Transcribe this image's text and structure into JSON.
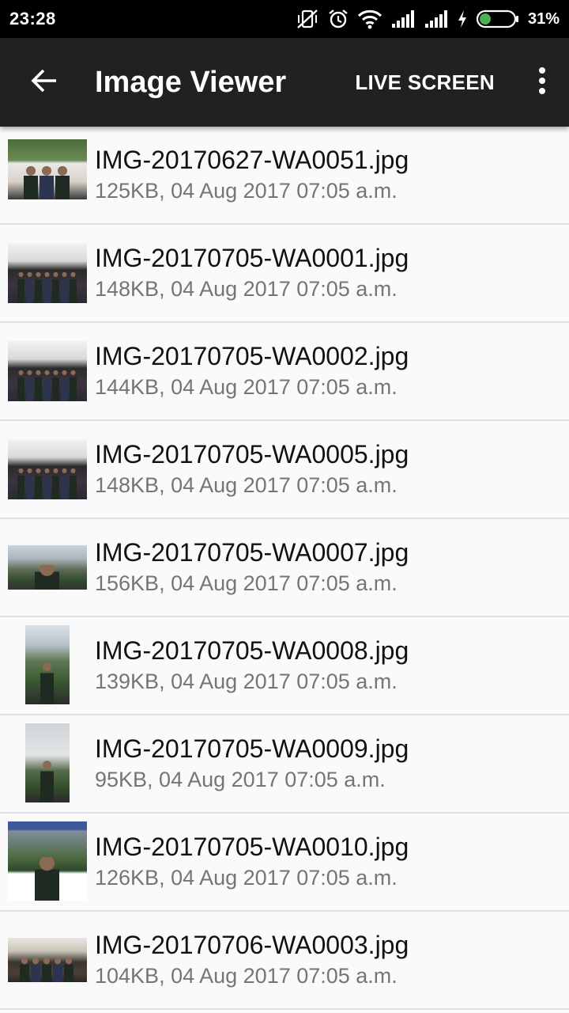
{
  "status_bar": {
    "time": "23:28",
    "battery_percent": "31%",
    "battery_level": 0.31,
    "icons": [
      "vibrate-off-icon",
      "alarm-icon",
      "wifi-icon",
      "signal-icon",
      "signal-icon",
      "charging-icon",
      "battery-icon"
    ]
  },
  "app_bar": {
    "back_icon": "arrow-back-icon",
    "title": "Image Viewer",
    "live_screen_label": "LIVE SCREEN",
    "more_icon": "more-vert-icon"
  },
  "files": [
    {
      "name": "IMG-20170627-WA0051.jpg",
      "meta": "125KB, 04 Aug 2017 07:05 a.m.",
      "thumb": "landscape-group"
    },
    {
      "name": "IMG-20170705-WA0001.jpg",
      "meta": "148KB, 04 Aug 2017 07:05 a.m.",
      "thumb": "landscape-crowd"
    },
    {
      "name": "IMG-20170705-WA0002.jpg",
      "meta": "144KB, 04 Aug 2017 07:05 a.m.",
      "thumb": "landscape-crowd"
    },
    {
      "name": "IMG-20170705-WA0005.jpg",
      "meta": "148KB, 04 Aug 2017 07:05 a.m.",
      "thumb": "landscape-crowd"
    },
    {
      "name": "IMG-20170705-WA0007.jpg",
      "meta": "156KB, 04 Aug 2017 07:05 a.m.",
      "thumb": "landscape-outdoor"
    },
    {
      "name": "IMG-20170705-WA0008.jpg",
      "meta": "139KB, 04 Aug 2017 07:05 a.m.",
      "thumb": "portrait-outdoor"
    },
    {
      "name": "IMG-20170705-WA0009.jpg",
      "meta": "95KB, 04 Aug 2017 07:05 a.m.",
      "thumb": "portrait-sky"
    },
    {
      "name": "IMG-20170705-WA0010.jpg",
      "meta": "126KB, 04 Aug 2017 07:05 a.m.",
      "thumb": "screenshot-post"
    },
    {
      "name": "IMG-20170706-WA0003.jpg",
      "meta": "104KB, 04 Aug 2017 07:05 a.m.",
      "thumb": "landscape-indoor"
    }
  ],
  "colors": {
    "status_bar_bg": "#000000",
    "app_bar_bg": "#212121",
    "list_bg": "#fafafa",
    "divider": "#e0e0e0",
    "primary_text": "#111111",
    "secondary_text": "#757575",
    "battery_fill": "#4caf50"
  }
}
